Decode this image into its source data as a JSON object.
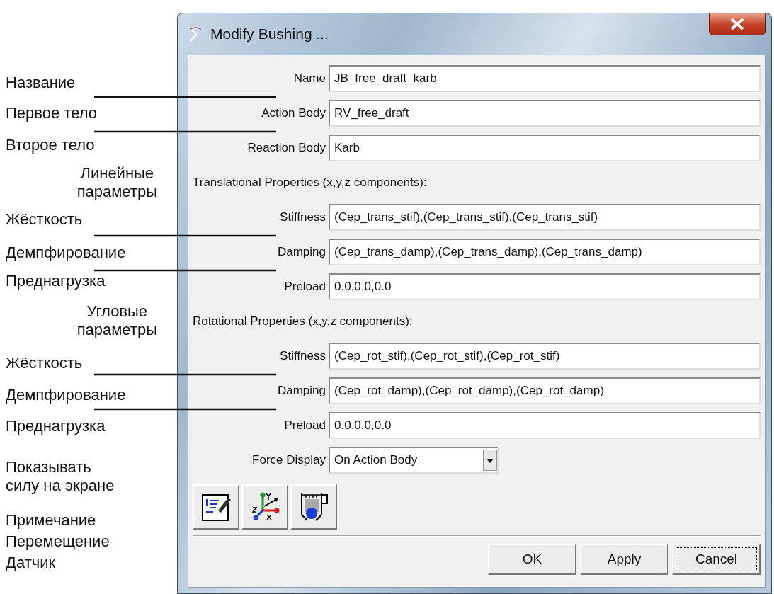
{
  "annotations": [
    {
      "kind": "label",
      "lines": [
        "Название"
      ]
    },
    {
      "kind": "label",
      "lines": [
        "Первое тело"
      ]
    },
    {
      "kind": "label",
      "lines": [
        "Второе тело"
      ]
    },
    {
      "kind": "heading",
      "lines": [
        "Линейные",
        "параметры"
      ]
    },
    {
      "kind": "label",
      "lines": [
        "Жёсткость"
      ]
    },
    {
      "kind": "label",
      "lines": [
        "Демпфирование"
      ]
    },
    {
      "kind": "label",
      "lines": [
        "Преднагрузка"
      ]
    },
    {
      "kind": "heading",
      "lines": [
        "Угловые",
        "параметры"
      ]
    },
    {
      "kind": "label",
      "lines": [
        "Жёсткость"
      ]
    },
    {
      "kind": "label",
      "lines": [
        "Демпфирование"
      ]
    },
    {
      "kind": "label",
      "lines": [
        "Преднагрузка"
      ]
    },
    {
      "kind": "label",
      "lines": [
        "Показывать",
        "силу на экране"
      ]
    },
    {
      "kind": "label",
      "lines": [
        "Примечание"
      ]
    },
    {
      "kind": "label",
      "lines": [
        "Перемещение"
      ]
    },
    {
      "kind": "label",
      "lines": [
        "Датчик"
      ]
    }
  ],
  "window": {
    "title": "Modify Bushing ..."
  },
  "rows": [
    {
      "kind": "field",
      "label": "Name",
      "value": "JB_free_draft_karb"
    },
    {
      "kind": "field",
      "label": "Action Body",
      "value": "RV_free_draft"
    },
    {
      "kind": "field",
      "label": "Reaction Body",
      "value": "Karb"
    },
    {
      "kind": "heading",
      "label": "Translational Properties (x,y,z components):"
    },
    {
      "kind": "field",
      "label": "Stiffness",
      "value": "(Cep_trans_stif),(Cep_trans_stif),(Cep_trans_stif)"
    },
    {
      "kind": "field",
      "label": "Damping",
      "value": "(Cep_trans_damp),(Cep_trans_damp),(Cep_trans_damp)"
    },
    {
      "kind": "field",
      "label": "Preload",
      "value": "0.0,0.0,0.0"
    },
    {
      "kind": "heading",
      "label": "Rotational Properties (x,y,z components):"
    },
    {
      "kind": "field",
      "label": "Stiffness",
      "value": "(Cep_rot_stif),(Cep_rot_stif),(Cep_rot_stif)"
    },
    {
      "kind": "field",
      "label": "Damping",
      "value": "(Cep_rot_damp),(Cep_rot_damp),(Cep_rot_damp)"
    },
    {
      "kind": "field",
      "label": "Preload",
      "value": "0.0,0.0,0.0"
    },
    {
      "kind": "select",
      "label": "Force Display",
      "value": "On Action Body"
    }
  ],
  "tools": [
    {
      "kind": "note"
    },
    {
      "kind": "axes"
    },
    {
      "kind": "gauge"
    }
  ],
  "buttons": [
    {
      "label": "OK",
      "focused": false
    },
    {
      "label": "Apply",
      "focused": false
    },
    {
      "label": "Cancel",
      "focused": true
    }
  ]
}
